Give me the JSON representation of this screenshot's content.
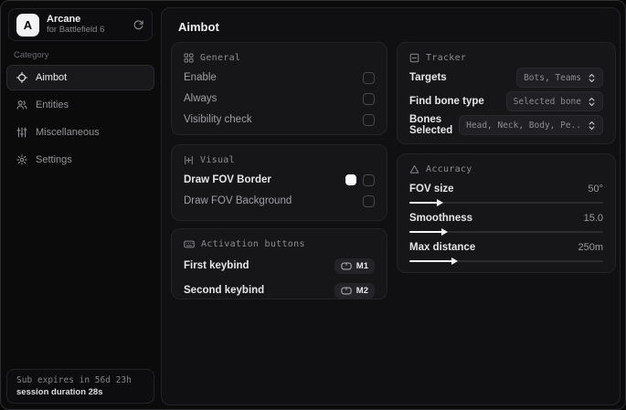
{
  "colors": {
    "window_bg": "#0b0b0c",
    "panel_bg": "#101013",
    "card_bg": "#161619",
    "card_border": "#242428",
    "text_primary": "#ececee",
    "text_muted": "#98989c",
    "swatch": "#ffffff",
    "slider_fill": "#f5f5f6"
  },
  "sidebar": {
    "logo_letter": "A",
    "app_name": "Arcane",
    "app_subtitle": "for Battlefield 6",
    "refresh_icon": "refresh-icon",
    "category_label": "Category",
    "items": [
      {
        "label": "Aimbot",
        "icon": "crosshair-icon",
        "active": true
      },
      {
        "label": "Entities",
        "icon": "users-icon",
        "active": false
      },
      {
        "label": "Miscellaneous",
        "icon": "sliders-icon",
        "active": false
      },
      {
        "label": "Settings",
        "icon": "gear-icon",
        "active": false
      }
    ],
    "sub_line1": "Sub expires in 56d 23h",
    "sub_line2": "session duration 28s"
  },
  "main": {
    "title": "Aimbot",
    "general": {
      "title": "General",
      "icon": "grid-icon",
      "rows": [
        {
          "label": "Enable",
          "checked": false
        },
        {
          "label": "Always",
          "checked": false
        },
        {
          "label": "Visibility check",
          "checked": false
        }
      ]
    },
    "visual": {
      "title": "Visual",
      "icon": "adjustments-icon",
      "rows": [
        {
          "label": "Draw FOV Border",
          "swatch": "#ffffff",
          "checked": false
        },
        {
          "label": "Draw FOV Background",
          "checked": false
        }
      ]
    },
    "activation": {
      "title": "Activation buttons",
      "icon": "keyboard-icon",
      "rows": [
        {
          "label": "First keybind",
          "key": "M1",
          "key_icon": "mouse-icon"
        },
        {
          "label": "Second keybind",
          "key": "M2",
          "key_icon": "mouse-icon"
        }
      ]
    },
    "tracker": {
      "title": "Tracker",
      "icon": "frame-minus-icon",
      "rows": [
        {
          "label": "Targets",
          "value": "Bots, Teams",
          "icon": "chevrons-up-down-icon"
        },
        {
          "label": "Find bone type",
          "value": "Selected bone",
          "icon": "chevrons-up-down-icon"
        },
        {
          "label": "Bones Selected",
          "value": "Head, Neck, Body, Pe..",
          "icon": "chevrons-up-down-icon"
        }
      ]
    },
    "accuracy": {
      "title": "Accuracy",
      "icon": "triangle-icon",
      "sliders": [
        {
          "label": "FOV size",
          "value": "50°",
          "percent": 14.5
        },
        {
          "label": "Smoothness",
          "value": "15.0",
          "percent": 17
        },
        {
          "label": "Max distance",
          "value": "250m",
          "percent": 22
        }
      ]
    }
  }
}
